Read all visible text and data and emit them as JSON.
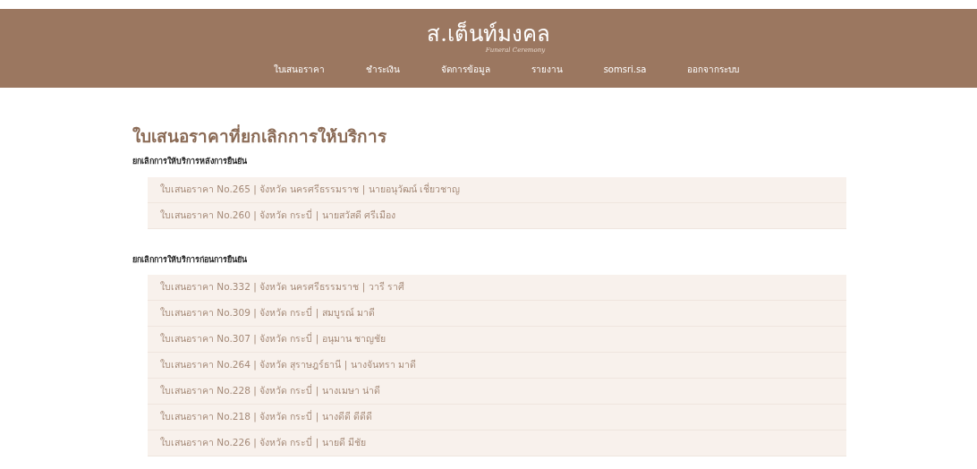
{
  "header": {
    "logo": "ส.เต็นท์มงคล",
    "logo_tagline": "Funeral Ceremony",
    "nav": [
      {
        "label": "ใบเสนอราคา"
      },
      {
        "label": "ชำระเงิน"
      },
      {
        "label": "จัดการข้อมูล"
      },
      {
        "label": "รายงาน"
      },
      {
        "label": "somsri.sa"
      },
      {
        "label": "ออกจากระบบ"
      }
    ]
  },
  "page_title": "ใบเสนอราคาที่ยกเลิกการให้บริการ",
  "sections": [
    {
      "heading": "ยกเลิกการให้บริการหลังการยืนยัน",
      "items": [
        "ใบเสนอราคา No.265 | จังหวัด นครศรีธรรมราช | นายอนุวัฒน์ เชี่ยวชาญ",
        "ใบเสนอราคา No.260 | จังหวัด กระบี่ | นายสวัสดี ศรีเมือง"
      ]
    },
    {
      "heading": "ยกเลิกการให้บริการก่อนการยืนยัน",
      "items": [
        "ใบเสนอราคา No.332 | จังหวัด นครศรีธรรมราช | วารี ราศี",
        "ใบเสนอราคา No.309 | จังหวัด กระบี่ | สมบูรณ์ มาดี",
        "ใบเสนอราคา No.307 | จังหวัด กระบี่ | อนุมาน ชาญชัย",
        "ใบเสนอราคา No.264 | จังหวัด สุราษฎร์ธานี | นางจันทรา มาดี",
        "ใบเสนอราคา No.228 | จังหวัด กระบี่ | นางเมษา น่าดี",
        "ใบเสนอราคา No.218 | จังหวัด กระบี่ | นางดีดี ดีดีดี",
        "ใบเสนอราคา No.226 | จังหวัด กระบี่ | นายดี มีชัย"
      ]
    }
  ]
}
